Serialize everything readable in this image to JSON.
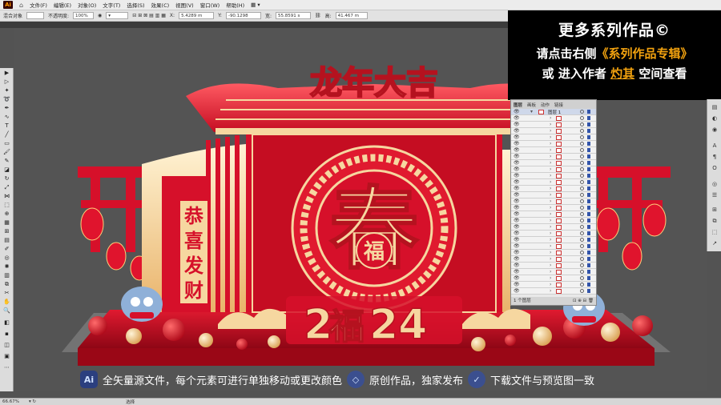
{
  "menubar": {
    "app_logo": "Ai",
    "items": [
      "文件(F)",
      "编辑(E)",
      "对象(O)",
      "文字(T)",
      "选择(S)",
      "效果(C)",
      "视图(V)",
      "窗口(W)",
      "帮助(H)"
    ]
  },
  "controlbar": {
    "selection_label": "混合对象",
    "opacity_label": "不透明度:",
    "opacity_value": "100%",
    "x_label": "X:",
    "x_value": "5.4289 m",
    "y_label": "Y:",
    "y_value": "-90.1298",
    "w_label": "宽:",
    "w_value": "55.8591 s",
    "h_label": "高:",
    "h_value": "41.467 m"
  },
  "promo": {
    "line1": "更多系列作品©",
    "line2_prefix": "请点击右侧",
    "line2_highlight": "《系列作品专辑》",
    "line3_prefix": "或  进入作者 ",
    "line3_highlight": "灼其",
    "line3_suffix": " 空间查看"
  },
  "artwork": {
    "title_top": "龙年大吉",
    "main_char": "春",
    "inner_char": "福",
    "side_banner": [
      "恭",
      "喜",
      "发",
      "财"
    ],
    "year_prefix": "2",
    "year_char": "福",
    "year_suffix": "24"
  },
  "layers_panel": {
    "tabs": [
      "图层",
      "画板",
      "动作",
      "链接"
    ],
    "top_layer": "图层 1",
    "footer": "1 个图层"
  },
  "infoband": {
    "badge1": "Ai",
    "text1": "全矢量源文件，每个元素可进行单独移动或更改颜色",
    "text2": "原创作品，独家发布",
    "text3": "下载文件与预览图一致"
  },
  "status": {
    "zoom": "66.67%",
    "tool": "选择"
  },
  "colors": {
    "red": "#d6102a",
    "gold": "#f6d7a0",
    "accent_orange": "#f2a20f",
    "floor_red": "#c10a1e"
  }
}
